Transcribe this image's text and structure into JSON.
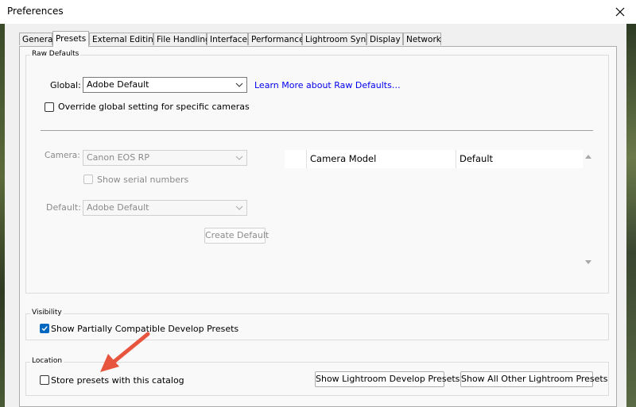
{
  "window": {
    "title": "Preferences"
  },
  "tabs": [
    {
      "label": "General"
    },
    {
      "label": "Presets"
    },
    {
      "label": "External Editing"
    },
    {
      "label": "File Handling"
    },
    {
      "label": "Interface"
    },
    {
      "label": "Performance"
    },
    {
      "label": "Lightroom Sync"
    },
    {
      "label": "Display"
    },
    {
      "label": "Network"
    }
  ],
  "active_tab": "Presets",
  "raw_defaults": {
    "group_label": "Raw Defaults",
    "global_label": "Global:",
    "global_value": "Adobe Default",
    "learn_more_link": "Learn More about Raw Defaults…",
    "override_label": "Override global setting for specific cameras",
    "override_checked": false,
    "camera_label": "Camera:",
    "camera_value": "Canon EOS RP",
    "show_serial_label": "Show serial numbers",
    "default_label": "Default:",
    "default_value": "Adobe Default",
    "create_default_button": "Create Default",
    "table": {
      "columns": [
        "Camera Model",
        "Default"
      ],
      "rows": []
    }
  },
  "visibility": {
    "group_label": "Visibility",
    "show_partial_label": "Show Partially Compatible Develop Presets",
    "show_partial_checked": true
  },
  "location": {
    "group_label": "Location",
    "store_with_catalog_label": "Store presets with this catalog",
    "store_with_catalog_checked": false,
    "show_develop_button": "Show Lightroom Develop Presets",
    "show_other_button": "Show All Other Lightroom Presets"
  },
  "colors": {
    "accent": "#0067c0",
    "link": "#0000ee",
    "annotation_arrow": "#e8553e"
  }
}
